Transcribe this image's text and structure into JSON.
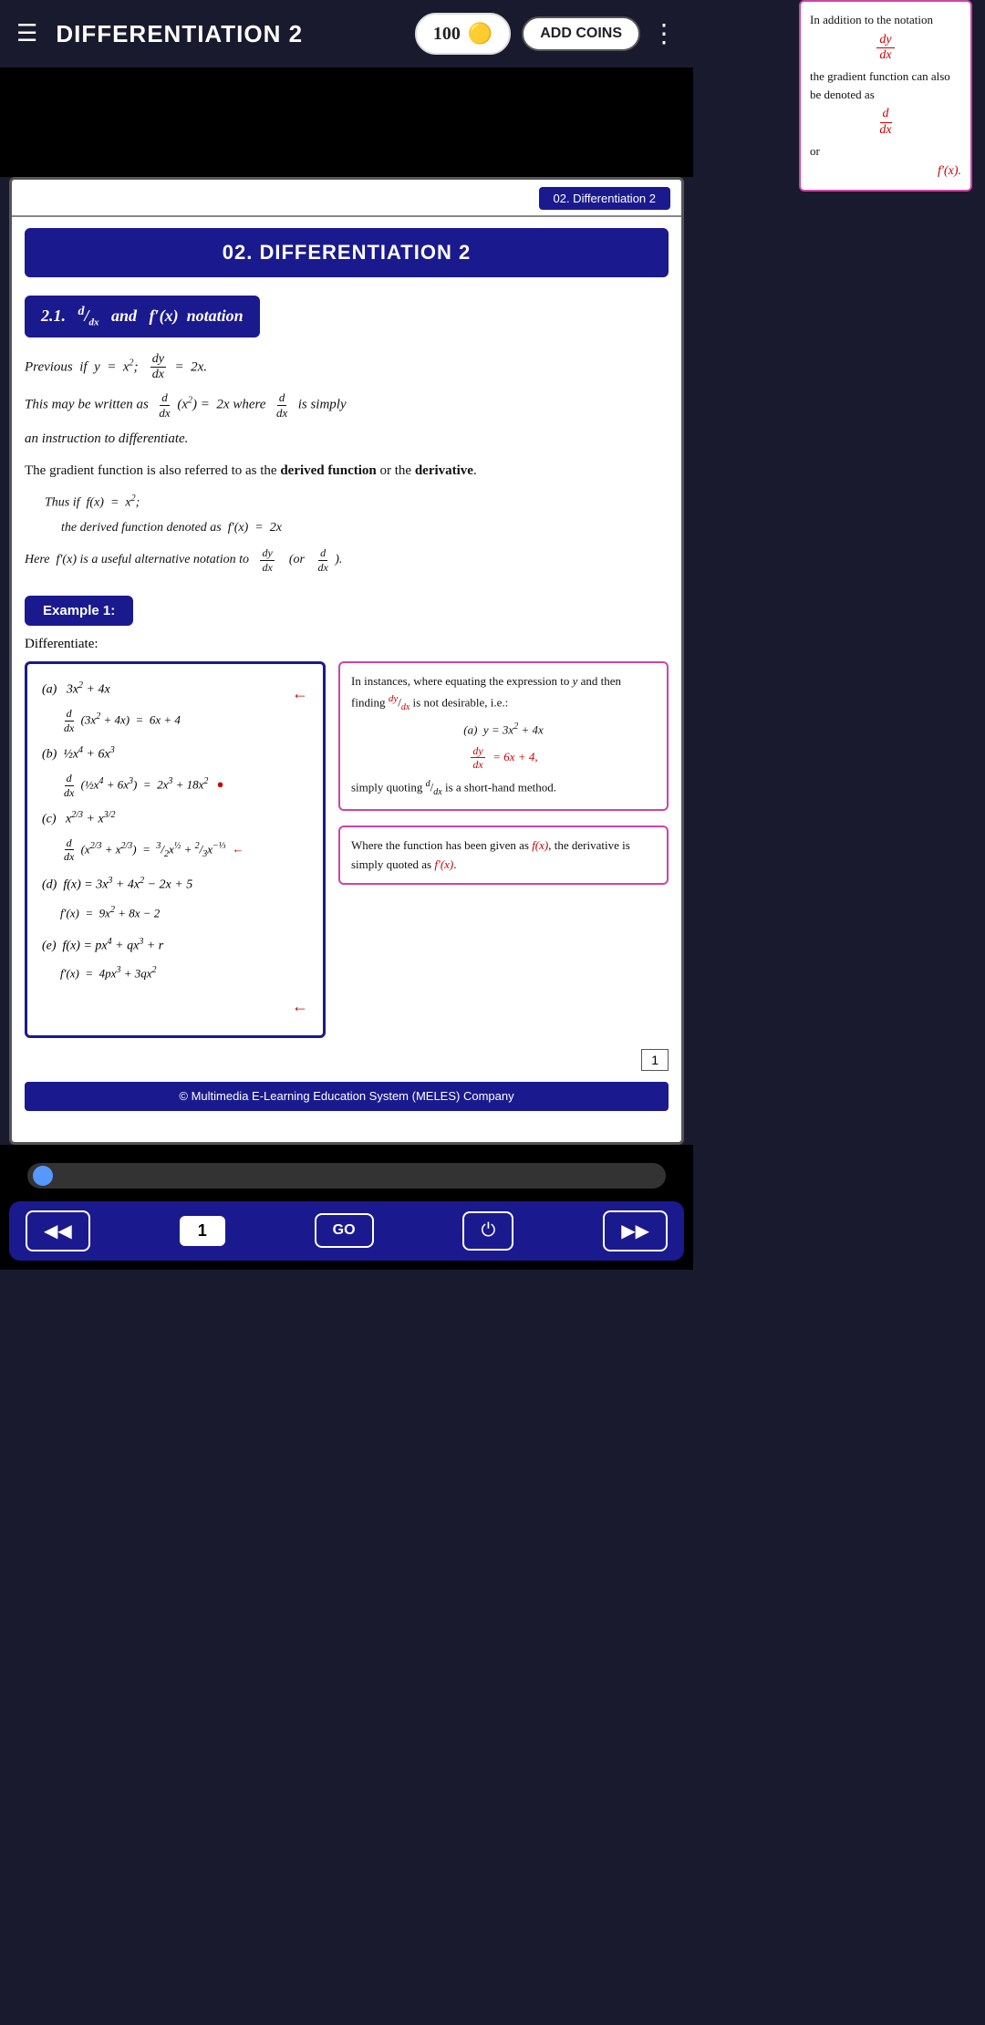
{
  "header": {
    "title": "DIFFERENTIATION 2",
    "coins": "100",
    "add_coins_label": "ADD COINS"
  },
  "breadcrumb": "02. Differentiation 2",
  "section_title": "02. DIFFERENTIATION 2",
  "subsection_title": "2.1.  d/dx  and  f′(x)  notation",
  "content": {
    "line1": "Previous  if  y  =  x²;",
    "line2": "dy/dx  =  2x.",
    "line3": "This may be written as  d/dx(x²)  =  2x  where  d/dx  is simply",
    "line4": "an instruction to differentiate.",
    "line5": "The gradient function is also referred to as the derived function or the derivative.",
    "line6": "Thus if  f(x)  =  x²;",
    "line7": "the derived function denoted as  f′(x)  =  2x",
    "line8": "Here  f′(x) is a useful alternative notation to  dy/dx  (or  d/dx)."
  },
  "side_note": {
    "text1": "In addition to the notation",
    "frac1_num": "dy",
    "frac1_den": "dx",
    "text2": "the gradient function can also be denoted as",
    "frac2_num": "d",
    "frac2_den": "dx",
    "text3": "or",
    "text4": "f′(x)."
  },
  "example_label": "Example 1:",
  "differentiate_label": "Differentiate:",
  "exercise": {
    "parts": [
      {
        "label": "(a)",
        "expr": "3x² + 4x",
        "result": "d/dx(3x² + 4x)  =  6x + 4"
      },
      {
        "label": "(b)",
        "expr": "½x⁴ + 6x³",
        "result": "d/dx(½x⁴ + 6x³)  =  2x³ + 18x²"
      },
      {
        "label": "(c)",
        "expr": "x^(2/3) + x^(3/2)",
        "result": "d/dx(x^(2/3) + x^(3/2))  =  (2/3)x^(-1/3) + (3/2)x^(1/2)"
      },
      {
        "label": "(d)",
        "expr": "f(x) = 3x³ + 4x² − 2x + 5",
        "result": "f′(x)  =  9x² + 8x − 2"
      },
      {
        "label": "(e)",
        "expr": "f(x) = px⁴ + qx³ + r",
        "result": "f′(x)  =  4px³ + 3qx²"
      }
    ]
  },
  "note_box1": {
    "text": "In instances, where equating the expression to y and then finding dy/dx is not desirable, i.e.:",
    "example_a": "(a)  y = 3x² + 4x",
    "example_frac": "dy/dx = 6x + 4,",
    "conclusion": "simply quoting d/dx is a short-hand method."
  },
  "note_box2": {
    "text": "Where the function has been given as f(x), the derivative is simply quoted as f′(x)."
  },
  "page_number": "1",
  "copyright": "© Multimedia E-Learning Education System (MELES) Company",
  "nav": {
    "back_label": "◀◀",
    "page_label": "1",
    "go_label": "GO",
    "power_label": "⏻",
    "forward_label": "▶▶"
  }
}
